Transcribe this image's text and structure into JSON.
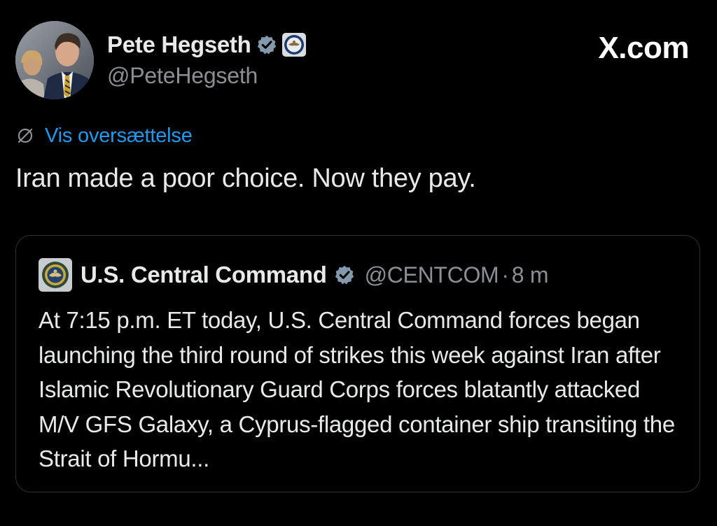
{
  "brand": {
    "label": "X.com"
  },
  "author": {
    "name": "Pete Hegseth",
    "handle": "@PeteHegseth",
    "avatar_icon": "profile-photo",
    "verified_icon": "verified-badge-icon",
    "affiliation_icon": "department-of-defense-seal-icon"
  },
  "translate": {
    "label": "Vis oversættelse",
    "icon": "translate-globe-icon"
  },
  "tweet": {
    "text": "Iran made a poor choice. Now they pay."
  },
  "quoted": {
    "name": "U.S. Central Command",
    "handle": "@CENTCOM",
    "separator": "·",
    "time": "8 m",
    "avatar_icon": "centcom-seal-icon",
    "verified_icon": "verified-badge-icon",
    "text": "At 7:15 p.m. ET today, U.S. Central Command forces began launching the third round of strikes this week against Iran after Islamic Revolutionary Guard Corps forces blatantly attacked M/V GFS Galaxy, a Cyprus-flagged container ship transiting the Strait of Hormu..."
  },
  "colors": {
    "background": "#000000",
    "text": "#e7e9ea",
    "secondary_text": "#8b8f94",
    "link": "#1d9bf0",
    "card_border": "#2f3336"
  }
}
